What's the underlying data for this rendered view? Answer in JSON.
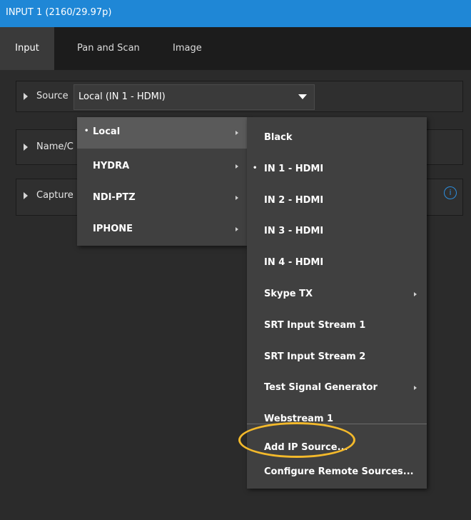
{
  "window": {
    "title": "INPUT 1 (2160/29.97p)"
  },
  "tabs": [
    {
      "label": "Input",
      "active": true
    },
    {
      "label": "Pan and Scan",
      "active": false
    },
    {
      "label": "Image",
      "active": false
    }
  ],
  "rows": {
    "source": {
      "label": "Source",
      "value": "Local (IN 1 - HDMI)"
    },
    "name": {
      "label": "Name/C"
    },
    "capture": {
      "label": "Capture"
    }
  },
  "source_menu": {
    "items": [
      {
        "label": "Local",
        "selected": true,
        "submenu": true
      },
      {
        "label": "HYDRA",
        "submenu": true
      },
      {
        "label": "NDI-PTZ",
        "submenu": true
      },
      {
        "label": "IPHONE",
        "submenu": true
      }
    ]
  },
  "local_menu": {
    "items": [
      {
        "label": "Black"
      },
      {
        "label": "IN 1 - HDMI",
        "selected": true
      },
      {
        "label": "IN 2 - HDMI"
      },
      {
        "label": "IN 3 - HDMI"
      },
      {
        "label": "IN 4 - HDMI"
      },
      {
        "label": "Skype TX",
        "submenu": true
      },
      {
        "label": "SRT Input Stream 1"
      },
      {
        "label": "SRT Input Stream 2"
      },
      {
        "label": "Test Signal Generator",
        "submenu": true
      },
      {
        "label": "Webstream 1"
      },
      {
        "label": "Add IP Source..."
      },
      {
        "label": "Configure Remote Sources..."
      }
    ]
  },
  "icons": {
    "info": "info-icon",
    "bullet": "•",
    "submenu": "chevron-right-icon",
    "dropdown": "chevron-down-icon"
  },
  "colors": {
    "titlebar": "#1f87d6",
    "highlight_ring": "#f3b92b",
    "info": "#2d8fe0"
  }
}
